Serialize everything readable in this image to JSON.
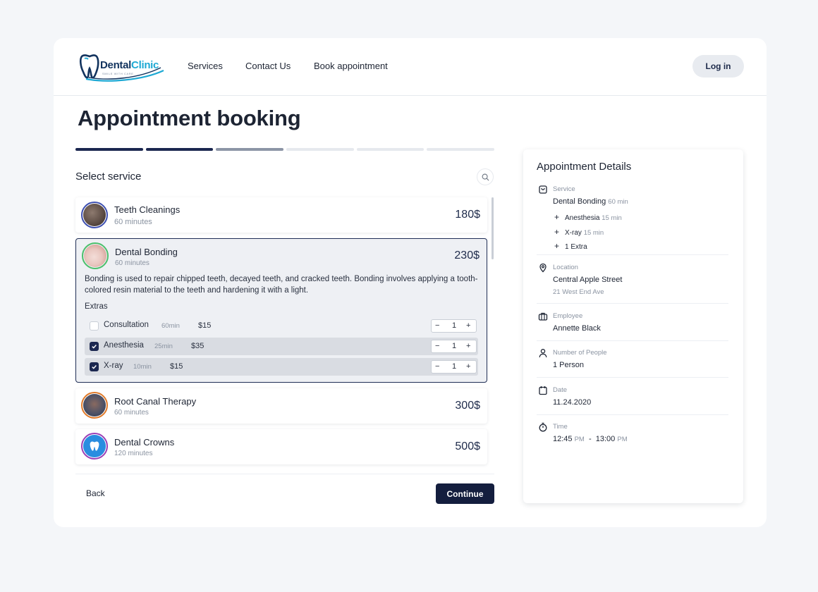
{
  "header": {
    "logo": {
      "dental": "Dental",
      "clinic": "Clinic",
      "tagline": "SMILE WITH CARE"
    },
    "nav": [
      "Services",
      "Contact Us",
      "Book appointment"
    ],
    "login_label": "Log in"
  },
  "page": {
    "title": "Appointment booking",
    "progress": {
      "total_steps": 6,
      "completed_steps": 2,
      "current_step": 3
    },
    "section_title": "Select service"
  },
  "services": [
    {
      "name": "Teeth Cleanings",
      "duration": "60 minutes",
      "price": "180$",
      "avatar_color": "#3d4fb0",
      "avatar_fill": "#5b4b43"
    },
    {
      "name": "Dental Bonding",
      "duration": "60 minutes",
      "price": "230$",
      "avatar_color": "#4bbf6b",
      "avatar_fill": "#e9c7c0",
      "description": "Bonding is used to repair chipped teeth, decayed teeth, and cracked teeth. Bonding involves applying a tooth-colored resin material to the teeth and hardening it with a light.",
      "extras_label": "Extras",
      "extras": [
        {
          "name": "Consultation",
          "duration": "60min",
          "price": "$15",
          "checked": false,
          "qty": "1"
        },
        {
          "name": "Anesthesia",
          "duration": "25min",
          "price": "$35",
          "checked": true,
          "qty": "1"
        },
        {
          "name": "X-ray",
          "duration": "10min",
          "price": "$15",
          "checked": true,
          "qty": "1"
        }
      ]
    },
    {
      "name": "Root Canal Therapy",
      "duration": "60 minutes",
      "price": "300$",
      "avatar_color": "#e07a2a",
      "avatar_fill": "#4a5066"
    },
    {
      "name": "Dental Crowns",
      "duration": "120 minutes",
      "price": "500$",
      "avatar_color": "#9b3fb6",
      "avatar_fill": "#2a8de0"
    }
  ],
  "footer": {
    "back_label": "Back",
    "continue_label": "Continue"
  },
  "details": {
    "title": "Appointment Details",
    "service": {
      "label": "Service",
      "value": "Dental Bonding",
      "sub": "60 min",
      "extras": [
        {
          "name": "Anesthesia",
          "duration": "15 min"
        },
        {
          "name": "X-ray",
          "duration": "15 min"
        },
        {
          "name": "1 Extra",
          "duration": ""
        }
      ]
    },
    "location": {
      "label": "Location",
      "value": "Central Apple Street",
      "sub": "21 West End Ave"
    },
    "employee": {
      "label": "Employee",
      "value": "Annette Black"
    },
    "people": {
      "label": "Number of People",
      "value": "1 Person"
    },
    "date": {
      "label": "Date",
      "value": "11.24.2020"
    },
    "time": {
      "label": "Time",
      "start": "12:45",
      "start_ampm": "PM",
      "separator": "-",
      "end": "13:00",
      "end_ampm": "PM"
    }
  },
  "colors": {
    "primary": "#141e3e",
    "accent": "#1ea9d4",
    "progress_done": "#1b2750",
    "progress_current": "#8c95a6",
    "progress_todo": "#e6e9ee"
  }
}
